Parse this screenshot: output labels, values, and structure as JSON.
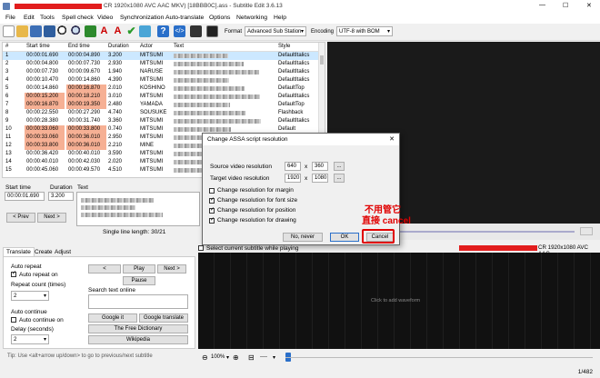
{
  "titlebar": {
    "title": "CR 1920x1080 AVC AAC MKV) [18BBB0C].ass - Subtitle Edit 3.6.13",
    "minimize": "—",
    "maximize": "☐",
    "close": "✕"
  },
  "menu": [
    "File",
    "Edit",
    "Tools",
    "Spell check",
    "Video",
    "Synchronization",
    "Auto-translate",
    "Options",
    "Networking",
    "Help"
  ],
  "toolbar": {
    "format_label": "Format",
    "format_value": "Advanced Sub Station",
    "encoding_label": "Encoding",
    "encoding_value": "UTF-8 with BOM",
    "icons": [
      "new-file",
      "open-folder",
      "save",
      "save-as",
      "find",
      "replace",
      "fix-errors",
      "remove-formatting",
      "spell-check",
      "help",
      "source-view",
      "video",
      "waveform"
    ]
  },
  "grid": {
    "headers": [
      "#",
      "Start time",
      "End time",
      "Duration",
      "Actor",
      "Text",
      "Style"
    ],
    "rows": [
      {
        "n": "1",
        "start": "00:00:01.690",
        "end": "00:00:04.890",
        "dur": "3.200",
        "actor": "MITSUMI",
        "style": "DefaultItalics"
      },
      {
        "n": "2",
        "start": "00:00:04.800",
        "end": "00:00:07.730",
        "dur": "2.930",
        "actor": "MITSUMI",
        "style": "DefaultItalics"
      },
      {
        "n": "3",
        "start": "00:00:07.730",
        "end": "00:00:09.670",
        "dur": "1.940",
        "actor": "NARUSE",
        "style": "DefaultItalics"
      },
      {
        "n": "4",
        "start": "00:00:10.470",
        "end": "00:00:14.860",
        "dur": "4.390",
        "actor": "MITSUMI",
        "style": "DefaultItalics"
      },
      {
        "n": "5",
        "start": "00:00:14.860",
        "end": "00:00:16.870",
        "dur": "2.010",
        "actor": "KOSHINO",
        "style": "DefaultTop"
      },
      {
        "n": "6",
        "start": "00:00:15.200",
        "end": "00:00:18.210",
        "dur": "3.010",
        "actor": "MITSUMI",
        "style": "DefaultItalics"
      },
      {
        "n": "7",
        "start": "00:00:16.870",
        "end": "00:00:19.350",
        "dur": "2.480",
        "actor": "YAMADA",
        "style": "DefaultTop"
      },
      {
        "n": "8",
        "start": "00:00:22.550",
        "end": "00:00:27.290",
        "dur": "4.740",
        "actor": "SOUSUKE",
        "style": "Flashback"
      },
      {
        "n": "9",
        "start": "00:00:28.380",
        "end": "00:00:31.740",
        "dur": "3.360",
        "actor": "MITSUMI",
        "style": "DefaultItalics"
      },
      {
        "n": "10",
        "start": "00:00:33.060",
        "end": "00:00:33.800",
        "dur": "0.740",
        "actor": "MITSUMI",
        "style": "Default"
      },
      {
        "n": "11",
        "start": "00:00:33.060",
        "end": "00:00:36.010",
        "dur": "2.950",
        "actor": "MITSUMI",
        "style": "DefaultItalics"
      },
      {
        "n": "12",
        "start": "00:00:33.800",
        "end": "00:00:36.010",
        "dur": "2.210",
        "actor": "MINE",
        "style": "Default"
      },
      {
        "n": "13",
        "start": "00:00:36.420",
        "end": "00:00:40.010",
        "dur": "3.590",
        "actor": "MITSUMI",
        "style": "Default"
      },
      {
        "n": "14",
        "start": "00:00:40.010",
        "end": "00:00:42.030",
        "dur": "2.020",
        "actor": "MITSUMI",
        "style": "Default"
      },
      {
        "n": "15",
        "start": "00:00:45.060",
        "end": "00:00:49.570",
        "dur": "4.510",
        "actor": "MITSUMI",
        "style": "Default"
      }
    ]
  },
  "editor": {
    "start_label": "Start time",
    "start_value": "00:00:01.690",
    "duration_label": "Duration",
    "duration_value": "3.200",
    "text_label": "Text",
    "prev": "< Prev",
    "next": "Next >",
    "line_length": "Single line length: 30/21"
  },
  "tabs": [
    "Translate",
    "Create",
    "Adjust"
  ],
  "translate": {
    "auto_repeat": "Auto repeat",
    "auto_repeat_on": "Auto repeat on",
    "repeat_count_label": "Repeat count (times)",
    "repeat_count_value": "2",
    "auto_continue": "Auto continue",
    "auto_continue_on": "Auto continue on",
    "delay_label": "Delay (seconds)",
    "delay_value": "2",
    "prev_btn": "<",
    "play_btn": "Play",
    "next_btn": "Next >",
    "pause_btn": "Pause",
    "search_label": "Search text online",
    "google_it": "Google it",
    "google_translate": "Google translate",
    "free_dictionary": "The Free Dictionary",
    "wikipedia": "Wikipedia"
  },
  "tip": "Tip: Use <alt+arrow up/down> to go to previous/next subtitle",
  "video_bar": {
    "select_current": "Select current subtitle while playing",
    "file_info": "CR 1920x1080 AVC AAC"
  },
  "waveform": {
    "placeholder": "Click to add waveform",
    "zoom": "100%",
    "speed": "----"
  },
  "status": {
    "position": "1/482"
  },
  "dialog": {
    "title": "Change ASSA script resolution",
    "source_label": "Source video resolution",
    "source_w": "640",
    "source_h": "360",
    "target_label": "Target video resolution",
    "target_w": "1920",
    "target_h": "1080",
    "x": "x",
    "browse": "...",
    "options": [
      {
        "label": "Change resolution for margin",
        "checked": false
      },
      {
        "label": "Change resolution for font size",
        "checked": true
      },
      {
        "label": "Change resolution for position",
        "checked": true
      },
      {
        "label": "Change resolution for drawing",
        "checked": true
      }
    ],
    "no_never": "No, never",
    "ok": "OK",
    "cancel": "Cancel"
  },
  "annotation": {
    "line1": "不用管它",
    "line2": "直接 cancel"
  },
  "colors": {
    "selected_row": "#cce8ff",
    "overlap_highlight": "#f6b094",
    "annotation_red": "#e00000",
    "redaction_red": "#e21d1d"
  }
}
